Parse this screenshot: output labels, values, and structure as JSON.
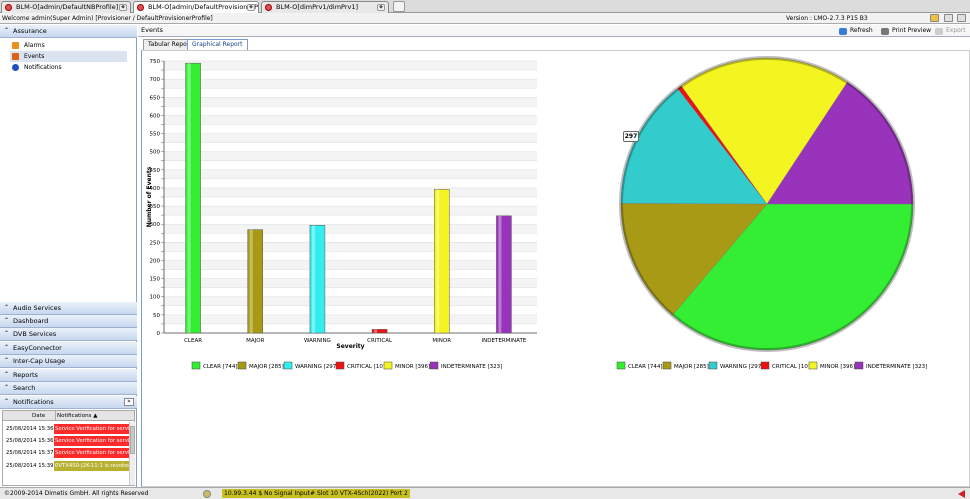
{
  "tabs": [
    {
      "label": "BLM-O[admin/DefaultNBProfile]"
    },
    {
      "label": "BLM-O[admin/DefaultProvisionerPr..."
    },
    {
      "label": "BLM-O[dimPrv1/dimPrv1]"
    }
  ],
  "welcome": "Welcome admin(Super Admin) [Provisioner / DefaultProvisionerProfile]",
  "version": "Version : LMO-2.7.3 P15 B3",
  "sidebar": {
    "top_header": "Assurance",
    "tree": [
      "Alarms",
      "Events",
      "Notifications"
    ],
    "sections": [
      "Audio Services",
      "Dashboard",
      "DVB Services",
      "EasyConnector",
      "Inter-Cap Usage",
      "Reports",
      "Search",
      "Notifications"
    ],
    "collapse_btn": "»"
  },
  "notif_table": {
    "headers": [
      "Date",
      "Notifications"
    ],
    "sort_glyph": "▲",
    "rows": [
      {
        "date": "25/08/2014 15:36",
        "msg": "Service Verification for servi",
        "color": "#ff2a2a"
      },
      {
        "date": "25/08/2014 15:36",
        "msg": "Service Verification for servi",
        "color": "#ff2a2a"
      },
      {
        "date": "25/08/2014 15:37",
        "msg": "Service Verification for servi",
        "color": "#ff2a2a"
      },
      {
        "date": "25/08/2014 15:39",
        "msg": "0VTX4S0-J2K-11:1 is revoked",
        "color": "#b8b030"
      }
    ]
  },
  "events": {
    "title": "Events",
    "toolbar": {
      "refresh": "Refresh",
      "print": "Print Preview",
      "export": "Export"
    },
    "tabs": [
      "Tabular Report",
      "Graphical Report"
    ]
  },
  "status": {
    "copyright": "©2009-2014 Dimetis GmbH. All rights Reserved",
    "alert": "10.99.3.44 $ No Signal Input# Slot 10 VTX-4Sch(2022) Port 2"
  },
  "chart_data": [
    {
      "type": "bar",
      "categories": [
        "CLEAR",
        "MAJOR",
        "WARNING",
        "CRITICAL",
        "MINOR",
        "INDETERMINATE"
      ],
      "values": [
        744,
        285,
        297,
        10,
        396,
        323
      ],
      "colors": [
        "#33ee33",
        "#a89a14",
        "#33eeee",
        "#ee1111",
        "#f4f420",
        "#9933bb"
      ],
      "xlabel": "Severity",
      "ylabel": "Number of Events",
      "ylim": [
        0,
        750
      ],
      "yticks": [
        0,
        25,
        50,
        75,
        100,
        125,
        150,
        175,
        200,
        225,
        250,
        275,
        300,
        325,
        350,
        375,
        400,
        425,
        450,
        475,
        500,
        525,
        550,
        575,
        600,
        625,
        650,
        675,
        700,
        725,
        750
      ],
      "ytick_labels": [
        "0",
        "",
        "50",
        "",
        "100",
        "",
        "150",
        "",
        "200",
        "",
        "250",
        "",
        "300",
        "",
        "350",
        "",
        "400",
        "",
        "450",
        "",
        "500",
        "",
        "550",
        "",
        "600",
        "",
        "650",
        "",
        "700",
        "",
        "750"
      ],
      "legend": [
        "CLEAR [744]",
        "MAJOR [285]",
        "WARNING [297]",
        "CRITICAL [10]",
        "MINOR [396]",
        "INDETERMINATE [323]"
      ],
      "grid": true
    },
    {
      "type": "pie",
      "categories": [
        "CLEAR",
        "MAJOR",
        "WARNING",
        "CRITICAL",
        "MINOR",
        "INDETERMINATE"
      ],
      "values": [
        744,
        285,
        297,
        10,
        396,
        323
      ],
      "colors": [
        "#33ee33",
        "#a89a14",
        "#33cccc",
        "#ee1111",
        "#f4f420",
        "#9933bb"
      ],
      "tooltip": "297",
      "legend": [
        "CLEAR [744]",
        "MAJOR [285]",
        "WARNING [297]",
        "CRITICAL [10]",
        "MINOR [396]",
        "INDETERMINATE [323]"
      ]
    }
  ]
}
